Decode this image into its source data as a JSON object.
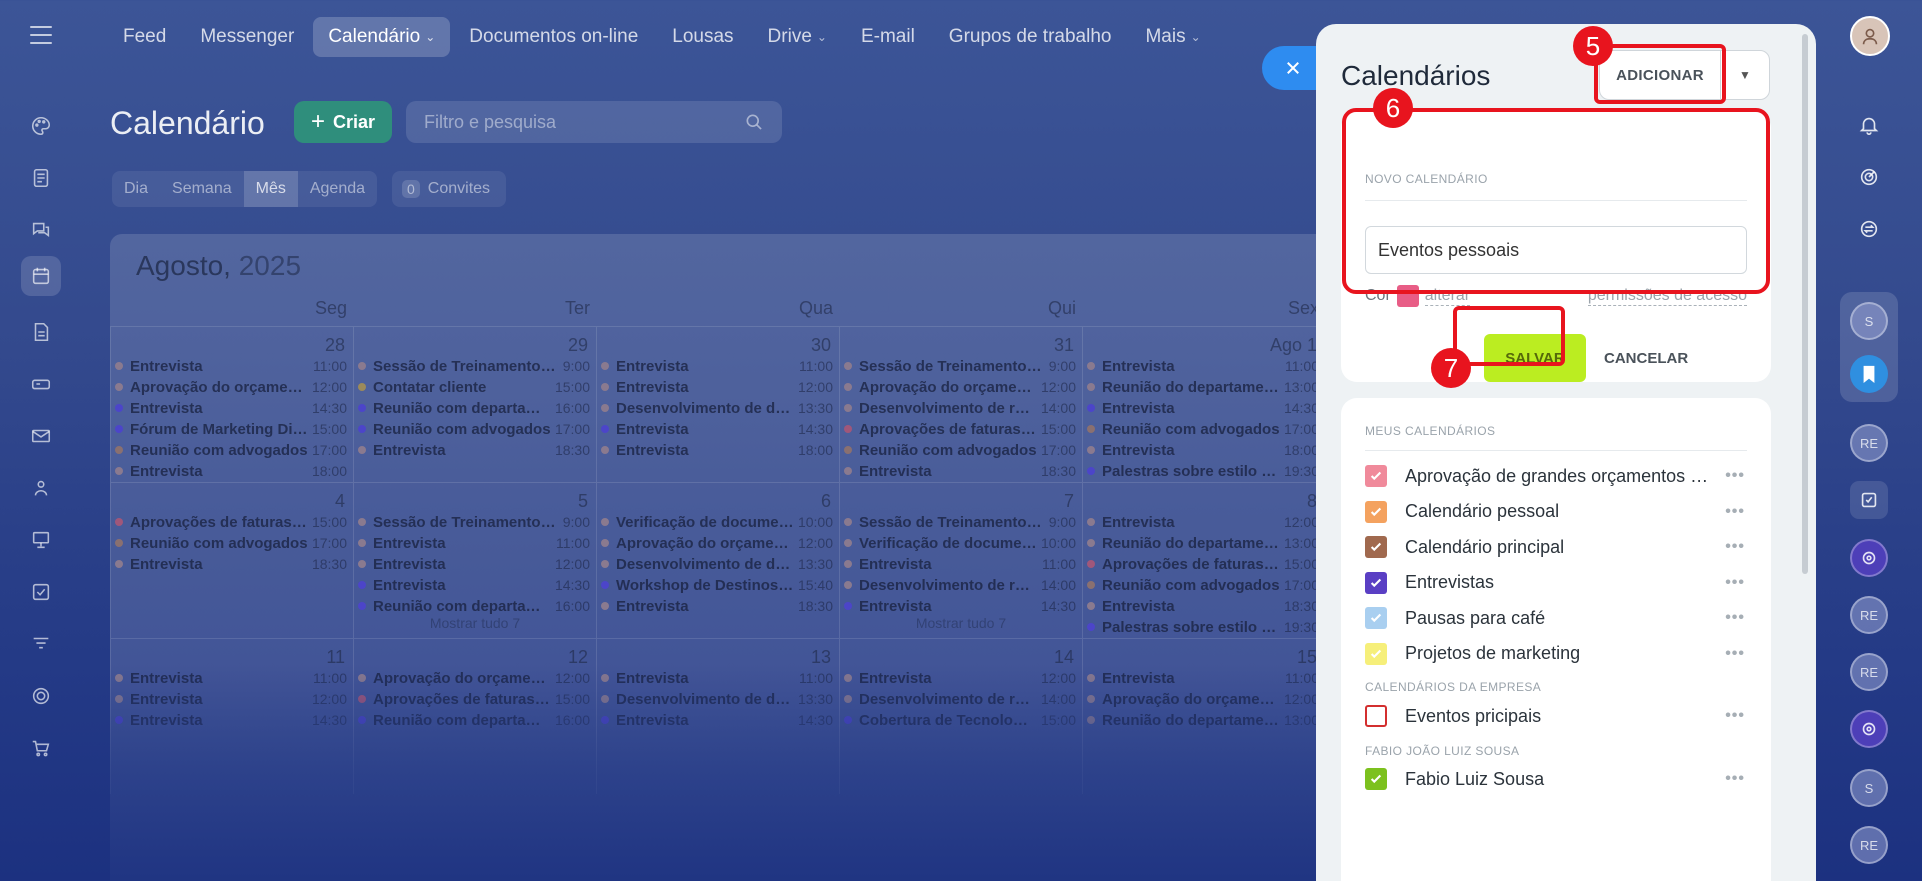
{
  "topnav": [
    {
      "label": "Feed",
      "active": false,
      "caret": false
    },
    {
      "label": "Messenger",
      "active": false,
      "caret": false
    },
    {
      "label": "Calendário",
      "active": true,
      "caret": true
    },
    {
      "label": "Documentos on-line",
      "active": false,
      "caret": false
    },
    {
      "label": "Lousas",
      "active": false,
      "caret": false
    },
    {
      "label": "Drive",
      "active": false,
      "caret": true
    },
    {
      "label": "E-mail",
      "active": false,
      "caret": false
    },
    {
      "label": "Grupos de trabalho",
      "active": false,
      "caret": false
    },
    {
      "label": "Mais",
      "active": false,
      "caret": true
    }
  ],
  "calendar": {
    "title": "Calendário",
    "create_label": "Criar",
    "search_placeholder": "Filtro e pesquisa",
    "views": [
      {
        "label": "Dia",
        "active": false
      },
      {
        "label": "Semana",
        "active": false
      },
      {
        "label": "Mês",
        "active": true
      },
      {
        "label": "Agenda",
        "active": false
      }
    ],
    "invites_count": "0",
    "invites_label": "Convites",
    "month": "Agosto,",
    "year": "2025",
    "weekdays": [
      "Seg",
      "Ter",
      "Qua",
      "Qui",
      "Sex"
    ],
    "show_all_label": "Mostrar tudo 7",
    "weeks": [
      {
        "days": [
          {
            "num": "28",
            "events": [
              [
                "Entrevista",
                "11:00",
                "#8a7a8f"
              ],
              [
                "Aprovação do orçament…",
                "12:00",
                "#8a7a8f"
              ],
              [
                "Entrevista",
                "14:30",
                "#4c45c9"
              ],
              [
                "Fórum de Marketing Di…",
                "15:00",
                "#4c45c9"
              ],
              [
                "Reunião com advogados",
                "17:00",
                "#8a7070"
              ],
              [
                "Entrevista",
                "18:00",
                "#8a7a8f"
              ]
            ]
          },
          {
            "num": "29",
            "events": [
              [
                "Sessão de Treinamento d…",
                "9:00",
                "#8a7a8f"
              ],
              [
                "Contatar cliente",
                "15:00",
                "#9c8a5a"
              ],
              [
                "Reunião com departam…",
                "16:00",
                "#4c45c9"
              ],
              [
                "Reunião com advogados",
                "17:00",
                "#4c45c9"
              ],
              [
                "Entrevista",
                "18:30",
                "#8a7a8f"
              ]
            ]
          },
          {
            "num": "30",
            "events": [
              [
                "Entrevista",
                "11:00",
                "#8a7a8f"
              ],
              [
                "Entrevista",
                "12:00",
                "#8a7a8f"
              ],
              [
                "Desenvolvimento de do…",
                "13:30",
                "#8a7a8f"
              ],
              [
                "Entrevista",
                "14:30",
                "#4c45c9"
              ],
              [
                "Entrevista",
                "18:00",
                "#8a7a8f"
              ]
            ]
          },
          {
            "num": "31",
            "events": [
              [
                "Sessão de Treinamento d…",
                "9:00",
                "#8a7a8f"
              ],
              [
                "Aprovação do orçament…",
                "12:00",
                "#8a7a8f"
              ],
              [
                "Desenvolvimento de reg…",
                "14:00",
                "#8a7a8f"
              ],
              [
                "Aprovações de faturas d…",
                "15:00",
                "#a0577a"
              ],
              [
                "Reunião com advogados",
                "17:00",
                "#8a7070"
              ],
              [
                "Entrevista",
                "18:30",
                "#8a7a8f"
              ]
            ]
          },
          {
            "num": "Ago 1",
            "events": [
              [
                "Entrevista",
                "11:00",
                "#8a7a8f"
              ],
              [
                "Reunião do departamen…",
                "13:00",
                "#8a7a8f"
              ],
              [
                "Entrevista",
                "14:30",
                "#4c45c9"
              ],
              [
                "Reunião com advogados",
                "17:00",
                "#8a7070"
              ],
              [
                "Entrevista",
                "18:00",
                "#8a7a8f"
              ],
              [
                "Palestras sobre estilo de…",
                "19:30",
                "#4c45c9"
              ]
            ]
          }
        ]
      },
      {
        "days": [
          {
            "num": "4",
            "events": [
              [
                "Aprovações de faturas d…",
                "15:00",
                "#a0577a"
              ],
              [
                "Reunião com advogados",
                "17:00",
                "#8a7070"
              ],
              [
                "Entrevista",
                "18:30",
                "#8a7a8f"
              ]
            ]
          },
          {
            "num": "5",
            "events": [
              [
                "Sessão de Treinamento d…",
                "9:00",
                "#8a7a8f"
              ],
              [
                "Entrevista",
                "11:00",
                "#8a7a8f"
              ],
              [
                "Entrevista",
                "12:00",
                "#8a7a8f"
              ],
              [
                "Entrevista",
                "14:30",
                "#4c45c9"
              ],
              [
                "Reunião com departam…",
                "16:00",
                "#4c45c9"
              ]
            ]
          },
          {
            "num": "6",
            "events": [
              [
                "Verificação de documen…",
                "10:00",
                "#8a7a8f"
              ],
              [
                "Aprovação do orçament…",
                "12:00",
                "#8a7a8f"
              ],
              [
                "Desenvolvimento de do…",
                "13:30",
                "#8a7a8f"
              ],
              [
                "Workshop de Destinos E…",
                "15:40",
                "#4c45c9"
              ],
              [
                "Entrevista",
                "18:30",
                "#8a7a8f"
              ]
            ]
          },
          {
            "num": "7",
            "events": [
              [
                "Sessão de Treinamento d…",
                "9:00",
                "#8a7a8f"
              ],
              [
                "Verificação de documen…",
                "10:00",
                "#8a7a8f"
              ],
              [
                "Entrevista",
                "11:00",
                "#8a7a8f"
              ],
              [
                "Desenvolvimento de reg…",
                "14:00",
                "#8a7a8f"
              ],
              [
                "Entrevista",
                "14:30",
                "#4c45c9"
              ]
            ]
          },
          {
            "num": "8",
            "events": [
              [
                "Entrevista",
                "12:00",
                "#8a7a8f"
              ],
              [
                "Reunião do departamen…",
                "13:00",
                "#8a7a8f"
              ],
              [
                "Aprovações de faturas d…",
                "15:00",
                "#a0577a"
              ],
              [
                "Reunião com advogados",
                "17:00",
                "#8a7070"
              ],
              [
                "Entrevista",
                "18:30",
                "#8a7a8f"
              ],
              [
                "Palestras sobre estilo de…",
                "19:30",
                "#4c45c9"
              ]
            ]
          }
        ]
      },
      {
        "days": [
          {
            "num": "11",
            "events": [
              [
                "Entrevista",
                "11:00",
                "#8a7a8f"
              ],
              [
                "Entrevista",
                "12:00",
                "#8a7a8f"
              ],
              [
                "Entrevista",
                "14:30",
                "#4c45c9"
              ]
            ]
          },
          {
            "num": "12",
            "events": [
              [
                "Aprovação do orçament…",
                "12:00",
                "#8a7a8f"
              ],
              [
                "Aprovações de faturas d…",
                "15:00",
                "#a0577a"
              ],
              [
                "Reunião com departam…",
                "16:00",
                "#4c45c9"
              ]
            ]
          },
          {
            "num": "13",
            "events": [
              [
                "Entrevista",
                "11:00",
                "#8a7a8f"
              ],
              [
                "Desenvolvimento de do…",
                "13:30",
                "#8a7a8f"
              ],
              [
                "Entrevista",
                "14:30",
                "#4c45c9"
              ]
            ]
          },
          {
            "num": "14",
            "events": [
              [
                "Entrevista",
                "12:00",
                "#8a7a8f"
              ],
              [
                "Desenvolvimento de reg…",
                "14:00",
                "#8a7a8f"
              ],
              [
                "Cobertura de Tecnolo…",
                "15:00",
                "#4c45c9"
              ]
            ]
          },
          {
            "num": "15",
            "events": [
              [
                "Entrevista",
                "11:00",
                "#8a7a8f"
              ],
              [
                "Aprovação do orçament…",
                "12:00",
                "#8a7a8f"
              ],
              [
                "Reunião do departamen…",
                "13:00",
                "#8a7a8f"
              ]
            ]
          }
        ]
      }
    ]
  },
  "panel": {
    "title": "Calendários",
    "add_label": "ADICIONAR",
    "new_section_label": "NOVO CALENDÁRIO",
    "name_value": "Eventos pessoais",
    "color_label": "Cor",
    "color_value": "#e85d86",
    "change_label": "alterar",
    "permissions_label": "permissões de acesso",
    "save_label": "SALVAR",
    "cancel_label": "CANCELAR",
    "my_calendars_label": "MEUS CALENDÁRIOS",
    "my_calendars": [
      {
        "name": "Aprovação de grandes orçamentos …",
        "color": "#f08a9b",
        "checked": true
      },
      {
        "name": "Calendário pessoal",
        "color": "#f4a25f",
        "checked": true
      },
      {
        "name": "Calendário principal",
        "color": "#a0694e",
        "checked": true
      },
      {
        "name": "Entrevistas",
        "color": "#5a3fc4",
        "checked": true
      },
      {
        "name": "Pausas para café",
        "color": "#a9cff0",
        "checked": true
      },
      {
        "name": "Projetos de marketing",
        "color": "#f6ef7a",
        "checked": true
      }
    ],
    "company_label": "CALENDÁRIOS DA EMPRESA",
    "company_calendars": [
      {
        "name": "Eventos pricipais",
        "color": "#d32f2f",
        "checked": false
      }
    ],
    "user_label": "FABIO JOÃO LUIZ SOUSA",
    "user_calendars": [
      {
        "name": "Fabio Luiz Sousa",
        "color": "#7cc11e",
        "checked": true
      }
    ],
    "more_glyph": "•••"
  },
  "rightrail": {
    "initials": [
      "S",
      "RE",
      "RE",
      "RE",
      "S",
      "RE"
    ]
  },
  "annotations": [
    "5",
    "6",
    "7"
  ]
}
